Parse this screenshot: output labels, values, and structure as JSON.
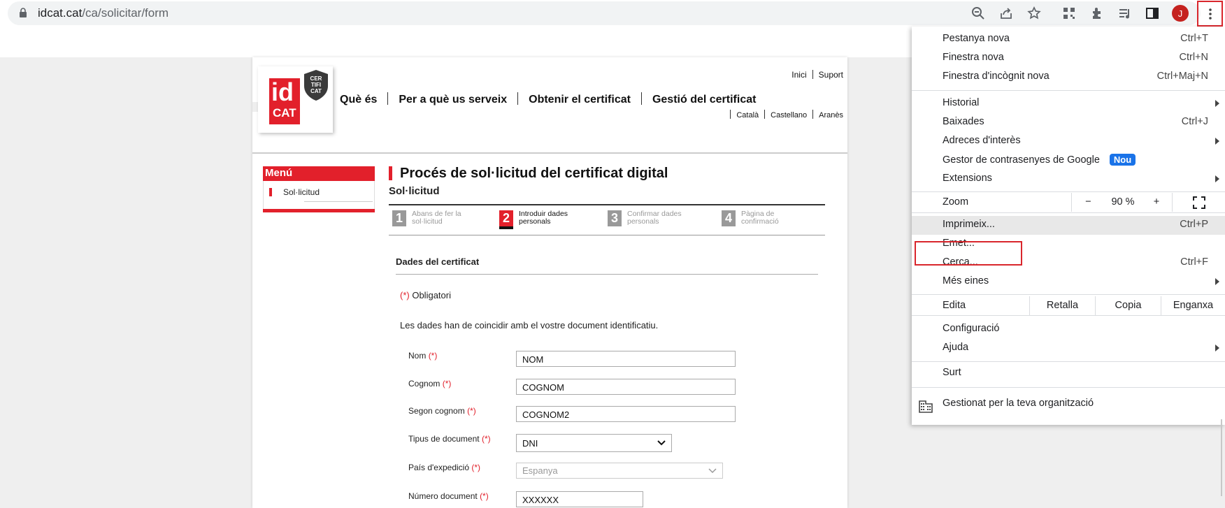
{
  "browser": {
    "url_host": "idcat.cat",
    "url_path": "/ca/solicitar/form",
    "avatar_initial": "J",
    "accent": "#d9262c"
  },
  "site": {
    "logo": {
      "id": "id",
      "cat": "CAT",
      "seal": [
        "CER",
        "TIFI",
        "CAT"
      ]
    },
    "top_links": [
      "Inici",
      "Suport"
    ],
    "nav": [
      "Què és",
      "Per a què us serveix",
      "Obtenir el certificat",
      "Gestió del certificat"
    ],
    "languages": [
      "Català",
      "Castellano",
      "Aranès"
    ],
    "brand_red": "#e2202b"
  },
  "sidebar": {
    "title": "Menú",
    "items": [
      "Sol·licitud"
    ]
  },
  "main": {
    "title": "Procés de sol·licitud del certificat digital",
    "subtitle": "Sol·licitud",
    "steps": [
      {
        "num": "1",
        "label": "Abans de fer la sol·licitud",
        "active": false
      },
      {
        "num": "2",
        "label": "Introduir dades personals",
        "active": true
      },
      {
        "num": "3",
        "label": "Confirmar dades personals",
        "active": false
      },
      {
        "num": "4",
        "label": "Pàgina de confirmació",
        "active": false
      }
    ],
    "section_title": "Dades del certificat",
    "required_mark": "(*)",
    "required_text": "Obligatori",
    "note": "Les dades han de coincidir amb el vostre document identificatiu.",
    "fields": [
      {
        "label": "Nom",
        "value": "NOM"
      },
      {
        "label": "Cognom",
        "value": "COGNOM"
      },
      {
        "label": "Segon cognom",
        "value": "COGNOM2"
      },
      {
        "label": "Tipus de document",
        "value": "DNI"
      },
      {
        "label": "País d'expedició",
        "value": "Espanya"
      },
      {
        "label": "Número document",
        "value": "XXXXXX"
      }
    ]
  },
  "chrome_menu": {
    "new_tab": {
      "label": "Pestanya nova",
      "shortcut": "Ctrl+T"
    },
    "new_window": {
      "label": "Finestra nova",
      "shortcut": "Ctrl+N"
    },
    "incognito": {
      "label": "Finestra d'incògnit nova",
      "shortcut": "Ctrl+Maj+N"
    },
    "history": {
      "label": "Historial"
    },
    "downloads": {
      "label": "Baixades",
      "shortcut": "Ctrl+J"
    },
    "bookmarks": {
      "label": "Adreces d'interès"
    },
    "passwords": {
      "label": "Gestor de contrasenyes de Google",
      "badge": "Nou"
    },
    "extensions": {
      "label": "Extensions"
    },
    "zoom": {
      "label": "Zoom",
      "minus": "−",
      "value": "90 %",
      "plus": "+"
    },
    "print": {
      "label": "Imprimeix...",
      "shortcut": "Ctrl+P"
    },
    "cast": {
      "label": "Emet..."
    },
    "find": {
      "label": "Cerca...",
      "shortcut": "Ctrl+F"
    },
    "more_tools": {
      "label": "Més eines"
    },
    "edit": {
      "label": "Edita",
      "cut": "Retalla",
      "copy": "Copia",
      "paste": "Enganxa"
    },
    "settings": {
      "label": "Configuració"
    },
    "help": {
      "label": "Ajuda"
    },
    "exit": {
      "label": "Surt"
    },
    "managed": {
      "label": "Gestionat per la teva organització"
    }
  }
}
